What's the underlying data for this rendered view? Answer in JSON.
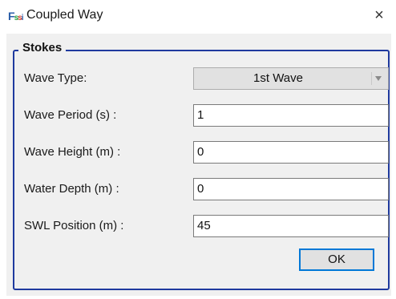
{
  "window": {
    "title": "Coupled Way",
    "icon_name": "fssi-app-icon",
    "close_glyph": "×",
    "close_icon": "close-icon"
  },
  "group": {
    "title": "Stokes"
  },
  "form": {
    "wave_type": {
      "label": "Wave Type:",
      "value": "1st Wave"
    },
    "wave_period": {
      "label": "Wave Period (s) :",
      "value": "1"
    },
    "wave_height": {
      "label": "Wave Height (m) :",
      "value": "0"
    },
    "water_depth": {
      "label": "Water Depth (m) :",
      "value": "0"
    },
    "swl_position": {
      "label": "SWL Position (m) :",
      "value": "45"
    }
  },
  "buttons": {
    "ok_label": "OK"
  },
  "colors": {
    "group_border": "#1f3a9e",
    "ok_focus": "#0078d7",
    "client_bg": "#f0f0f0"
  }
}
